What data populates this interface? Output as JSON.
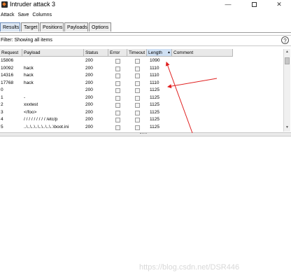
{
  "window": {
    "title": "Intruder attack 3",
    "minimize": "—",
    "close": "✕"
  },
  "menu": [
    "Attack",
    "Save",
    "Columns"
  ],
  "tabs": [
    "Results",
    "Target",
    "Positions",
    "Payloads",
    "Options"
  ],
  "active_tab": "Results",
  "filter": {
    "text": "Filter: Showing all items",
    "help": "?"
  },
  "table": {
    "columns": [
      "Request",
      "Payload",
      "Status",
      "Error",
      "Timeout",
      "Length",
      "Comment"
    ],
    "sort_indicator": "▲",
    "rows": [
      {
        "request": "15806",
        "payload": "",
        "status": "200",
        "length": "1090"
      },
      {
        "request": "10092",
        "payload": "hack",
        "status": "200",
        "length": "1110"
      },
      {
        "request": "14316",
        "payload": "hack",
        "status": "200",
        "length": "1110"
      },
      {
        "request": "17768",
        "payload": "hack",
        "status": "200",
        "length": "1110"
      },
      {
        "request": "0",
        "payload": "",
        "status": "200",
        "length": "1125"
      },
      {
        "request": "1",
        "payload": "-",
        "status": "200",
        "length": "1125"
      },
      {
        "request": "2",
        "payload": "xxxtest",
        "status": "200",
        "length": "1125"
      },
      {
        "request": "3",
        "payload": "</foo>",
        "status": "200",
        "length": "1125"
      },
      {
        "request": "4",
        "payload": "/ / / / / / / / / /etc/p",
        "status": "200",
        "length": "1125"
      },
      {
        "request": "5",
        "payload": "..\\..\\..\\..\\..\\..\\..\\..\\boot.ini",
        "status": "200",
        "length": "1125"
      }
    ]
  },
  "colors": {
    "annotation": "#e02020",
    "sorted_header": "#cfe0f3",
    "active_tab": "#dde7f3"
  },
  "watermark": "https://blog.csdn.net/DSR446"
}
